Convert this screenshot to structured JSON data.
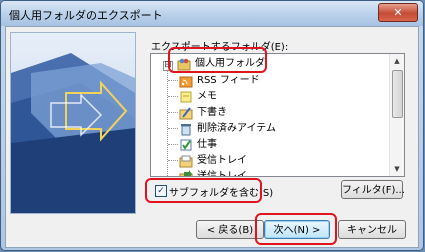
{
  "window": {
    "title": "個人用フォルダのエクスポート",
    "close_icon": "close-icon"
  },
  "colors": {
    "highlight": "#e0141e",
    "accent": "#3c7fb1"
  },
  "tree": {
    "label": "エクスポートするフォルダ(E):",
    "root": {
      "label": "個人用フォルダ",
      "icon": "personal-folders-icon",
      "expanded": "⊟"
    },
    "items": [
      {
        "label": "RSS フィード",
        "icon": "rss-folder-icon"
      },
      {
        "label": "メモ",
        "icon": "notes-icon"
      },
      {
        "label": "下書き",
        "icon": "drafts-icon"
      },
      {
        "label": "削除済みアイテム",
        "icon": "deleted-items-icon"
      },
      {
        "label": "仕事",
        "icon": "tasks-icon"
      },
      {
        "label": "受信トレイ",
        "icon": "inbox-icon"
      },
      {
        "label": "送信トレイ",
        "icon": "outbox-icon"
      }
    ]
  },
  "options": {
    "include_subfolders_label": "サブフォルダを含む(S)",
    "include_subfolders_checked": true,
    "check_mark": "✓"
  },
  "buttons": {
    "filter": "フィルタ(F)...",
    "back": "< 戻る(B)",
    "next": "次へ(N) >",
    "cancel": "キャンセル"
  }
}
